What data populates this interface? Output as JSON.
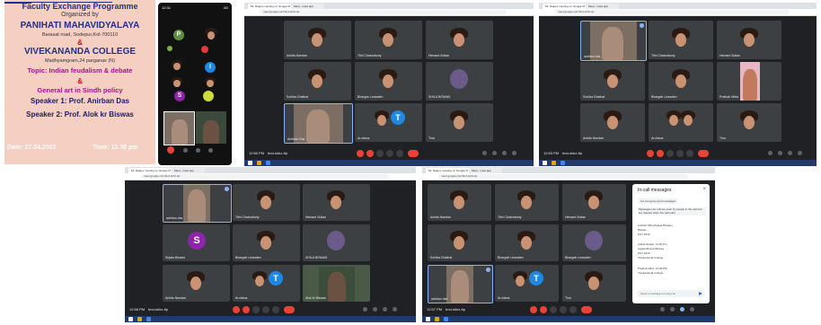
{
  "poster": {
    "title": "Faculty Exchange Programme",
    "organized": "Organized by",
    "college1": "PANIHATI MAHAVIDYALAYA",
    "address1": "Barasat road, Sodepur,Kol-700110",
    "amp1": "&",
    "college2": "VIVEKANANDA COLLEGE",
    "address2": "Madhyamgram,24 parganas (N)",
    "topic": "Topic: Indian feudalism & debate",
    "amp2": "&",
    "topic2": "General art in Sindh policy",
    "speaker1": "Speaker 1: Prof. Anirban Das",
    "speaker2": "Speaker 2: Prof. Alok kr Biswas",
    "date": "Date: 27.04.2022",
    "time": "Time: 12.30 pm"
  },
  "phone": {
    "status_left": "12:31",
    "status_right": "4G",
    "avatars": [
      "P",
      "D",
      "I",
      "S"
    ]
  },
  "windows": {
    "tab_label": "Mr. Rajeev meeting on Google M...",
    "tab2_label": "Meet - meet.app",
    "url": "meet.google.com/bnd-skhz-ttp",
    "w1": {
      "time": "12:50 PM",
      "code": "bnd-skhz-ttp",
      "names": [
        "Ankita Nandan",
        "Tithi Chakraborty",
        "Hemant Sultan",
        "Sohitra Dhaibat",
        "Bhargav Leanalen",
        "SHILA BISWAS",
        "Anirban Das",
        "Ar.sitaus",
        "Tina"
      ]
    },
    "w2": {
      "time": "12:53 PM",
      "code": "bnd-skhz-ttp",
      "names": [
        "anirban das",
        "Tithi Chakraborty",
        "Hemant Sultan",
        "Sohitra Dhaibat",
        "Bhargab Leanalen",
        "Prathab Mitra",
        "Ankita Nandan",
        "Ar.sitaus",
        "Tina"
      ]
    },
    "w3": {
      "time": "12:56 PM",
      "code": "bnd-skhz-ttp",
      "names": [
        "anirban das",
        "Tithi Chakraborty",
        "Hemant Sultan",
        "Sujata Biswas",
        "Bhargab Leanalen",
        "SHILA BISWAS",
        "Ankita Nandan",
        "Ar.sitaus",
        "Alok kr Biswas"
      ]
    },
    "w4": {
      "time": "12:57 PM",
      "code": "bnd-skhz-ttp",
      "names": [
        "Ankita Nandan",
        "Tithi Chakraborty",
        "Hemant Sultan",
        "Sohitra Dhaibat",
        "Bhargab Leanalen",
        "anirban das",
        "Ar.sitaus",
        "Tina"
      ]
    }
  },
  "chat": {
    "title": "In-call messages",
    "toggle": "Let everyone send messages",
    "notice": "Messages can only be seen by people in the call and are deleted when the call ends",
    "msgs": [
      "Anirban Mitra(Sujata Biswas)",
      "Biswas",
      "DST 2019",
      "Ankita Sarkar: 12:30 Pm",
      "Sujata Bhuina Biswas",
      "DST 2019",
      "Vivekananda College",
      "Prathab Mitra: 12:45 PM",
      "Vivekananda College"
    ],
    "input": "Send a message to everyone"
  }
}
